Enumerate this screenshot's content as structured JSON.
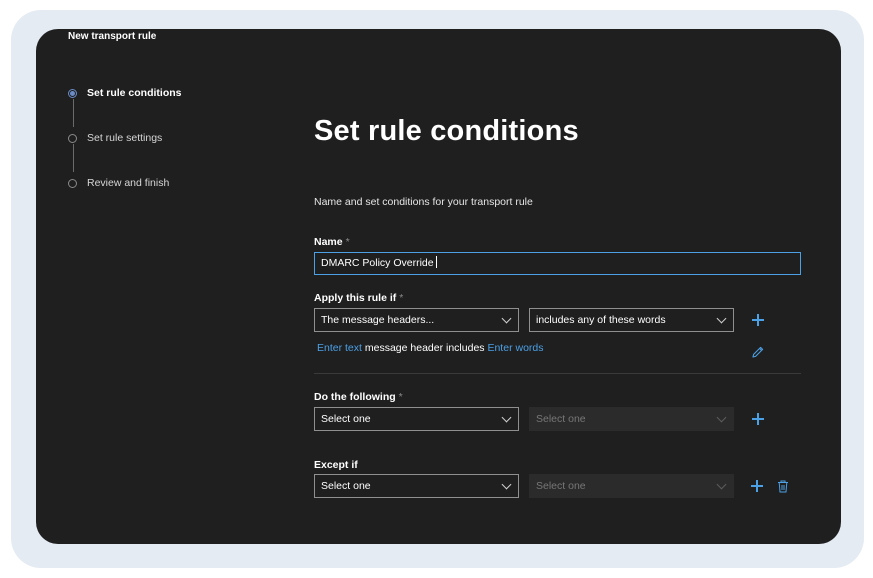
{
  "window": {
    "title": "New transport rule"
  },
  "steps": [
    {
      "label": "Set rule conditions",
      "state": "active"
    },
    {
      "label": "Set rule settings",
      "state": "pending"
    },
    {
      "label": "Review and finish",
      "state": "pending"
    }
  ],
  "main": {
    "heading": "Set rule conditions",
    "description": "Name and set conditions for your transport rule"
  },
  "name_field": {
    "label": "Name",
    "required_mark": "*",
    "value": "DMARC Policy Override"
  },
  "apply_if": {
    "label": "Apply this rule if",
    "required_mark": "*",
    "condition_select": "The message headers...",
    "operator_select": "includes any of these words",
    "link_enter_text": "Enter text",
    "summary_text": "message header includes",
    "link_enter_words": "Enter words"
  },
  "do_following": {
    "label": "Do the following",
    "required_mark": "*",
    "action_select": "Select one",
    "secondary_select": "Select one"
  },
  "except_if": {
    "label": "Except if",
    "condition_select": "Select one",
    "secondary_select": "Select one"
  },
  "icons": {
    "add": "plus-icon",
    "edit": "pencil-icon",
    "delete": "trash-icon",
    "dropdown": "chevron-down-icon"
  },
  "colors": {
    "accent": "#4ba0e6",
    "window_bg": "#1f1f1f",
    "frame_bg": "#e4ebf3"
  }
}
